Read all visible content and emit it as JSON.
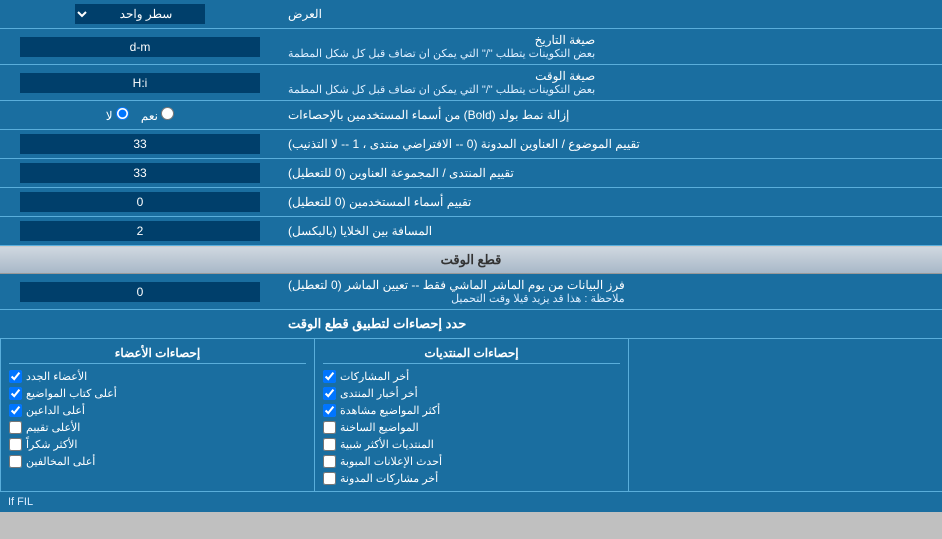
{
  "header": {
    "title": "العرض",
    "display_label": "سطر واحد"
  },
  "rows": [
    {
      "id": "date_format",
      "label": "صيغة التاريخ",
      "sublabel": "بعض التكوينات يتطلب \"/\" التي يمكن ان تضاف قبل كل شكل المطمة",
      "value": "d-m"
    },
    {
      "id": "time_format",
      "label": "صيغة الوقت",
      "sublabel": "بعض التكوينات يتطلب \"/\" التي يمكن ان تضاف قبل كل شكل المطمة",
      "value": "H:i"
    },
    {
      "id": "remove_bold",
      "label": "إزالة نمط بولد (Bold) من أسماء المستخدمين بالإحصاءات",
      "type": "radio",
      "options": [
        {
          "label": "نعم",
          "value": "yes"
        },
        {
          "label": "لا",
          "value": "no",
          "selected": true
        }
      ]
    },
    {
      "id": "topics_order",
      "label": "تقييم الموضوع / العناوين المدونة (0 -- الافتراضي منتدى ، 1 -- لا التذنيب)",
      "value": "33"
    },
    {
      "id": "forum_order",
      "label": "تقييم المنتدى / المجموعة العناوين (0 للتعطيل)",
      "value": "33"
    },
    {
      "id": "users_order",
      "label": "تقييم أسماء المستخدمين (0 للتعطيل)",
      "value": "0"
    },
    {
      "id": "cell_spacing",
      "label": "المسافة بين الخلايا (بالبكسل)",
      "value": "2"
    }
  ],
  "snapshot_section": {
    "header": "قطع الوقت",
    "row": {
      "label": "فرز البيانات من يوم الماشر الماشي فقط -- تعيين الماشر (0 لتعطيل)",
      "sublabel": "ملاحظة : هذا قد يزيد قيلا وقت التحميل",
      "value": "0"
    },
    "stats_header": "حدد إحصاءات لتطبيق قطع الوقت"
  },
  "checkboxes": {
    "col1_header": "إحصاءات الأعضاء",
    "col2_header": "إحصاءات المنتديات",
    "col3_header": "",
    "col1_items": [
      {
        "label": "الأعضاء الجدد",
        "checked": true
      },
      {
        "label": "أعلى كتاب المواضيع",
        "checked": true
      },
      {
        "label": "أعلى الداعين",
        "checked": true
      },
      {
        "label": "الأعلى تقييم",
        "checked": false
      },
      {
        "label": "الأكثر شكراً",
        "checked": false
      },
      {
        "label": "أعلى المخالفين",
        "checked": false
      }
    ],
    "col2_items": [
      {
        "label": "أخر المشاركات",
        "checked": true
      },
      {
        "label": "أخر أخبار المنتدى",
        "checked": true
      },
      {
        "label": "أكثر المواضيع مشاهدة",
        "checked": true
      },
      {
        "label": "المواضيع الساخنة",
        "checked": false
      },
      {
        "label": "المنتديات الأكثر شبية",
        "checked": false
      },
      {
        "label": "أحدث الإعلانات المبوبة",
        "checked": false
      },
      {
        "label": "أخر مشاركات المدونة",
        "checked": false
      }
    ]
  }
}
